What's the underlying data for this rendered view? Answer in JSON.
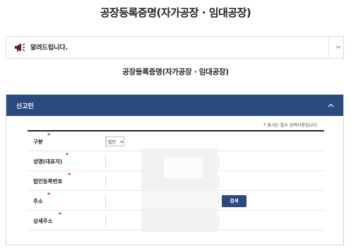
{
  "page": {
    "title": "공장등록증명(자가공장 · 임대공장)",
    "subtitle": "공장등록증명(자가공장 · 임대공장)"
  },
  "notice": {
    "label": "알려드립니다.",
    "icon": "megaphone-icon"
  },
  "applicant_panel": {
    "header": "신고인",
    "required_note": "표시는 필수 입력사항입니다.",
    "required_marker": "*",
    "fields": {
      "type_label": "구분",
      "type_value": "법인",
      "name_label": "성명(대표자)",
      "corp_no_label": "법인등록번호",
      "address_label": "주소",
      "address_detail_label": "상세주소"
    },
    "search_button": "검색"
  },
  "colors": {
    "accent": "#2b4a7e",
    "required": "#d21f1f"
  }
}
